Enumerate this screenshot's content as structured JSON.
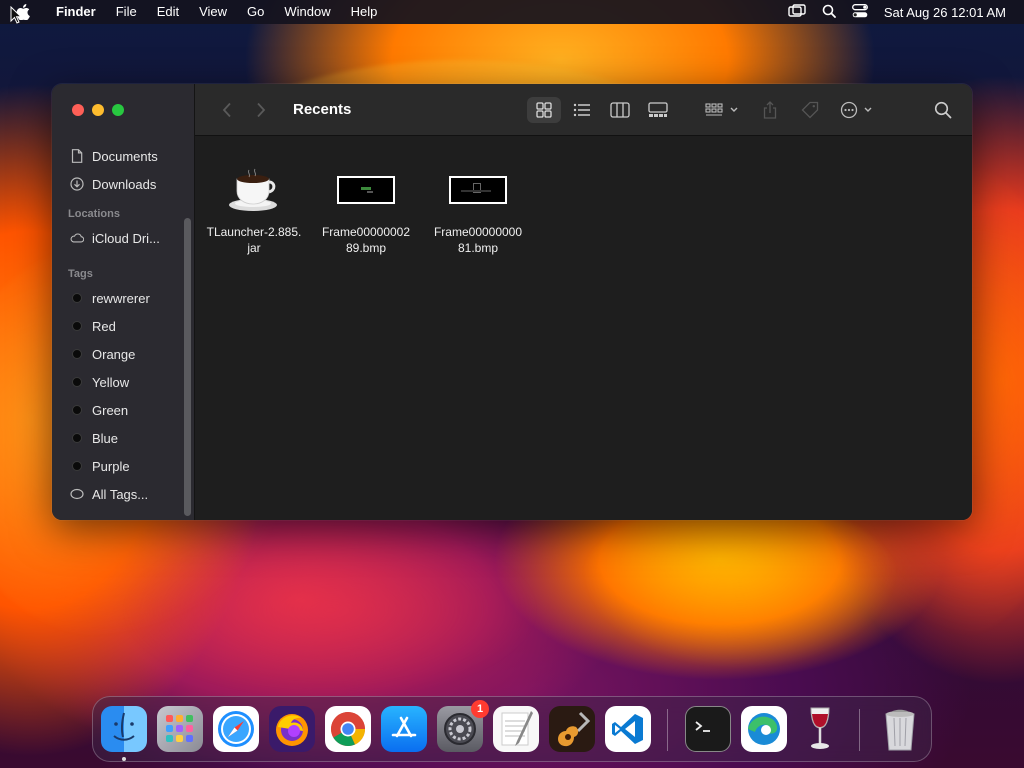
{
  "menubar": {
    "app_name": "Finder",
    "menus": [
      "File",
      "Edit",
      "View",
      "Go",
      "Window",
      "Help"
    ],
    "clock": "Sat Aug 26  12:01 AM"
  },
  "window": {
    "title": "Recents",
    "sidebar": {
      "favorites": [
        {
          "label": "Documents",
          "icon": "document-icon"
        },
        {
          "label": "Downloads",
          "icon": "download-icon"
        }
      ],
      "locations_heading": "Locations",
      "locations": [
        {
          "label": "iCloud Dri...",
          "icon": "cloud-icon"
        }
      ],
      "tags_heading": "Tags",
      "tags": [
        {
          "label": "rewwrerer"
        },
        {
          "label": "Red"
        },
        {
          "label": "Orange"
        },
        {
          "label": "Yellow"
        },
        {
          "label": "Green"
        },
        {
          "label": "Blue"
        },
        {
          "label": "Purple"
        }
      ],
      "all_tags": "All Tags..."
    },
    "files": [
      {
        "line1": "TLauncher-2.885.",
        "line2": "jar",
        "icon": "java-cup-icon"
      },
      {
        "line1": "Frame00000002",
        "line2": "89.bmp",
        "icon": "bmp-thumbnail"
      },
      {
        "line1": "Frame00000000",
        "line2": "81.bmp",
        "icon": "bmp-thumbnail"
      }
    ]
  },
  "dock": {
    "apps": [
      "Finder",
      "Launchpad",
      "Safari",
      "Firefox",
      "Chrome",
      "App Store",
      "System Settings",
      "TextEdit",
      "GarageBand",
      "Visual Studio Code",
      "Terminal",
      "Microsoft Edge",
      "Wine",
      "Trash"
    ],
    "settings_badge": "1"
  },
  "colors": {
    "window_bg": "#1e1e1e",
    "sidebar_bg": "#2b2a30",
    "close": "#fe5f57",
    "minimize": "#febc2e",
    "zoom": "#28c840"
  }
}
